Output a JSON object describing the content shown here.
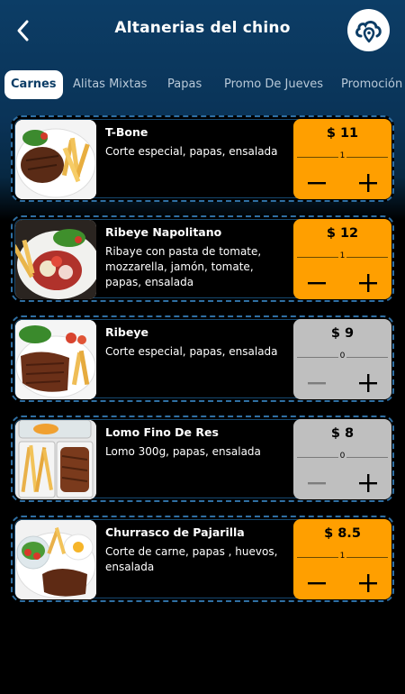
{
  "header": {
    "title": "Altanerias del chino",
    "back_icon": "chevron-left-icon",
    "location_icon": "cloud-location-icon"
  },
  "tabs": [
    {
      "label": "Carnes",
      "active": true
    },
    {
      "label": "Alitas Mixtas",
      "active": false
    },
    {
      "label": "Papas",
      "active": false
    },
    {
      "label": "Promo De Jueves",
      "active": false
    },
    {
      "label": "Promoción D",
      "active": false
    }
  ],
  "products": [
    {
      "name": "T-Bone",
      "description": "Corte especial, papas, ensalada",
      "price": "$ 11",
      "quantity": "1",
      "selected": true
    },
    {
      "name": "Ribeye Napolitano",
      "description": "Ribaye con pasta de tomate, mozzarella, jamón, tomate, papas, ensalada",
      "price": "$ 12",
      "quantity": "1",
      "selected": true
    },
    {
      "name": "Ribeye",
      "description": "Corte especial, papas, ensalada",
      "price": "$ 9",
      "quantity": "0",
      "selected": false
    },
    {
      "name": "Lomo Fino De Res",
      "description": "Lomo 300g, papas, ensalada",
      "price": "$ 8",
      "quantity": "0",
      "selected": false
    },
    {
      "name": "Churrasco de Pajarilla",
      "description": "Corte de carne, papas , huevos, ensalada",
      "price": "$ 8.5",
      "quantity": "1",
      "selected": true
    }
  ],
  "colors": {
    "header_blue": "#0c3d66",
    "price_selected": "#ff9f00",
    "price_unselected": "#bfbfbf",
    "card_border": "#2f6fa3"
  }
}
